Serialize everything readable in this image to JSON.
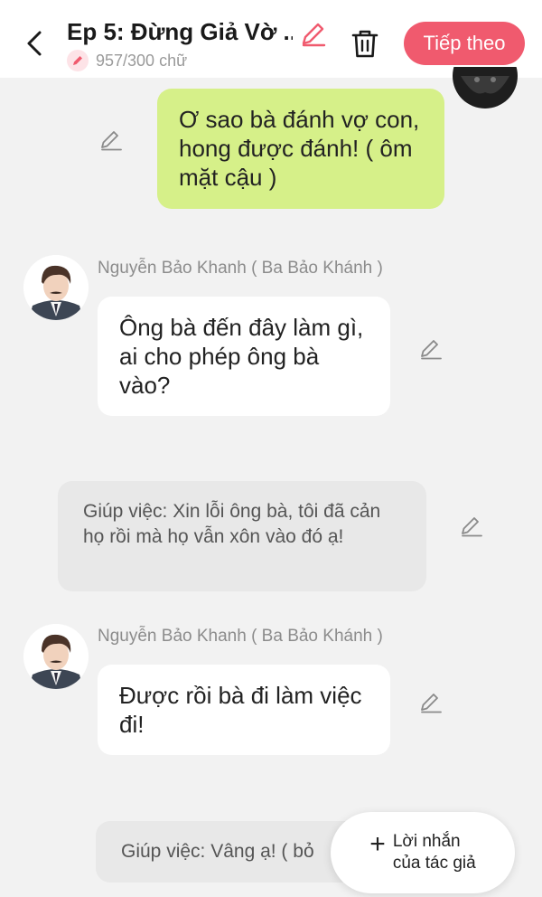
{
  "header": {
    "title": "Ep 5: Đừng Giả Vờ ...",
    "word_count": "957/300 chữ",
    "next_label": "Tiếp theo",
    "accent_color": "#f05a6e"
  },
  "messages": [
    {
      "type": "sent",
      "text": "Ơ sao bà đánh vợ con, hong được đánh! ( ôm mặt cậu )"
    },
    {
      "type": "received",
      "speaker": "Nguyễn Bảo Khanh ( Ba Bảo Khánh )",
      "text": "Ông bà đến đây làm gì, ai cho phép ông bà vào?"
    },
    {
      "type": "narration",
      "text": "Giúp việc: Xin lỗi ông bà, tôi đã cản họ rồi mà họ vẫn xôn vào đó ạ!"
    },
    {
      "type": "received",
      "speaker": "Nguyễn Bảo Khanh ( Ba Bảo Khánh )",
      "text": "Được rồi bà đi làm việc đi!"
    },
    {
      "type": "narration",
      "text": "Giúp việc: Vâng ạ! ( bỏ"
    }
  ],
  "author_note": {
    "line1": "Lời nhắn",
    "line2": "của tác giả"
  }
}
